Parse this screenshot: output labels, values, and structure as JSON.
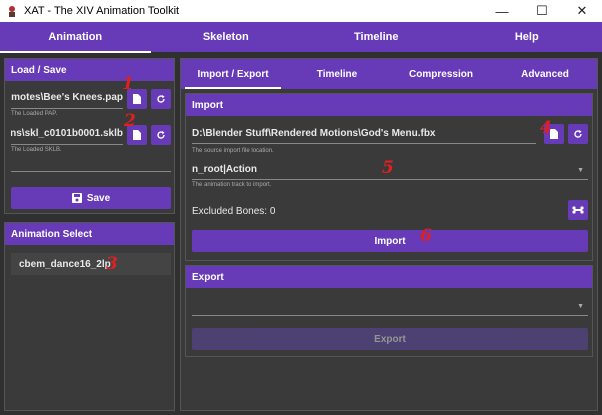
{
  "window": {
    "title": "XAT - The XIV Animation Toolkit",
    "controls": [
      "—",
      "☐",
      "✕"
    ]
  },
  "main_tabs": [
    {
      "label": "Animation",
      "active": true
    },
    {
      "label": "Skeleton",
      "active": false
    },
    {
      "label": "Timeline",
      "active": false
    },
    {
      "label": "Help",
      "active": false
    }
  ],
  "load_save": {
    "header": "Load / Save",
    "pap_value": "Emotes\\Bee's Knees.pap",
    "pap_hint": "The Loaded PAP.",
    "sklb_value": "ns\\skl_c0101b0001.sklb",
    "sklb_hint": "The Loaded SKLB.",
    "save_label": "Save"
  },
  "animation_select": {
    "header": "Animation Select",
    "items": [
      "cbem_dance16_2lp"
    ]
  },
  "sub_tabs": [
    {
      "label": "Import / Export",
      "active": true
    },
    {
      "label": "Timeline",
      "active": false
    },
    {
      "label": "Compression",
      "active": false
    },
    {
      "label": "Advanced",
      "active": false
    }
  ],
  "import": {
    "header": "Import",
    "file_value": "D:\\Blender Stuff\\Rendered Motions\\God's Menu.fbx",
    "file_hint": "The source import file location.",
    "track_value": "n_root|Action",
    "track_hint": "The animation track to import.",
    "excluded_label": "Excluded Bones: 0",
    "import_label": "Import"
  },
  "export": {
    "header": "Export",
    "select_value": "",
    "export_label": "Export"
  },
  "annotations": [
    "1",
    "2",
    "3",
    "4",
    "5",
    "6"
  ],
  "colors": {
    "accent": "#673ab7",
    "background": "#303030",
    "annotation": "#e02020"
  }
}
